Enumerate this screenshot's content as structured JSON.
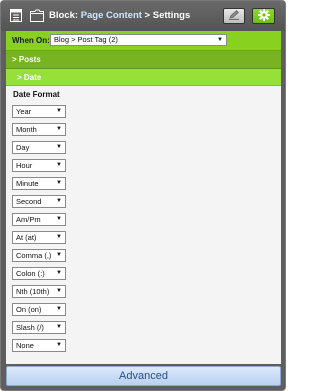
{
  "header": {
    "prefix": "Block: ",
    "link": "Page Content",
    "suffix": " > Settings"
  },
  "when_on": {
    "label": "When On:",
    "value": "Blog > Post Tag (2)"
  },
  "sections": {
    "posts": "> Posts",
    "date": "> Date"
  },
  "date_format": {
    "label": "Date Format",
    "selects": [
      "Year",
      "Month",
      "Day",
      "Hour",
      "Minute",
      "Second",
      "Am/Pm",
      "At (at)",
      "Comma (,)",
      "Colon (:)",
      "Nth (10th)",
      "On (on)",
      "Slash (/)",
      "None"
    ]
  },
  "footer": {
    "label": "Advanced"
  },
  "colors": {
    "accent_green": "#88d11f",
    "dark_green": "#78b421",
    "light_green": "#97e038",
    "footer_text": "#2a4d8a"
  },
  "icons": {
    "header_left": "list-icon",
    "header_block": "folder-icon",
    "edit": "pencil-icon",
    "settings": "gear-icon",
    "dropdown": "chevron-down-icon"
  }
}
